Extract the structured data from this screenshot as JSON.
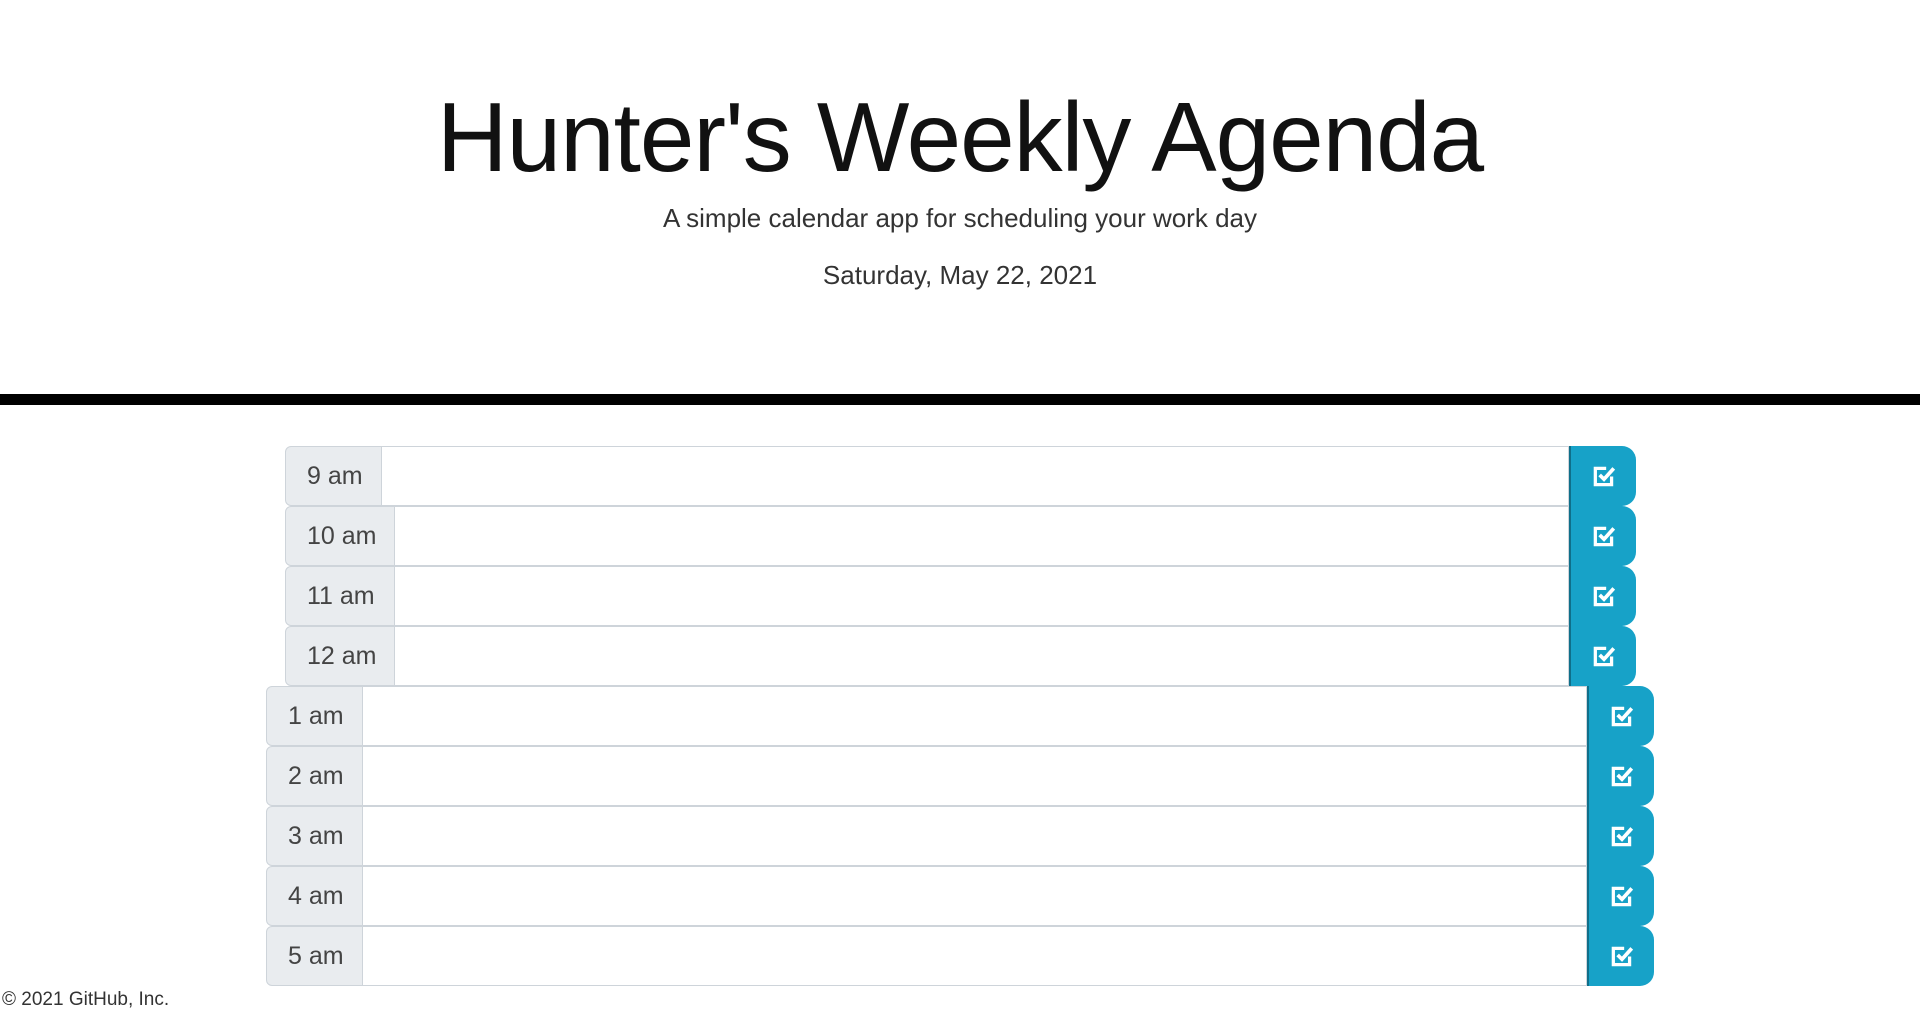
{
  "header": {
    "title": "Hunter's Weekly Agenda",
    "subtitle": "A simple calendar app for scheduling your work day",
    "date": "Saturday, May 22, 2021"
  },
  "schedule": {
    "rows": [
      {
        "hour": "9 am",
        "task": ""
      },
      {
        "hour": "10 am",
        "task": ""
      },
      {
        "hour": "11 am",
        "task": ""
      },
      {
        "hour": "12 am",
        "task": ""
      },
      {
        "hour": "1 am",
        "task": ""
      },
      {
        "hour": "2 am",
        "task": ""
      },
      {
        "hour": "3 am",
        "task": ""
      },
      {
        "hour": "4 am",
        "task": ""
      },
      {
        "hour": "5 am",
        "task": ""
      }
    ],
    "save_icon": "check-square-icon",
    "save_color": "#17a2c8"
  },
  "footer": {
    "text": "© 2021 GitHub, Inc."
  }
}
